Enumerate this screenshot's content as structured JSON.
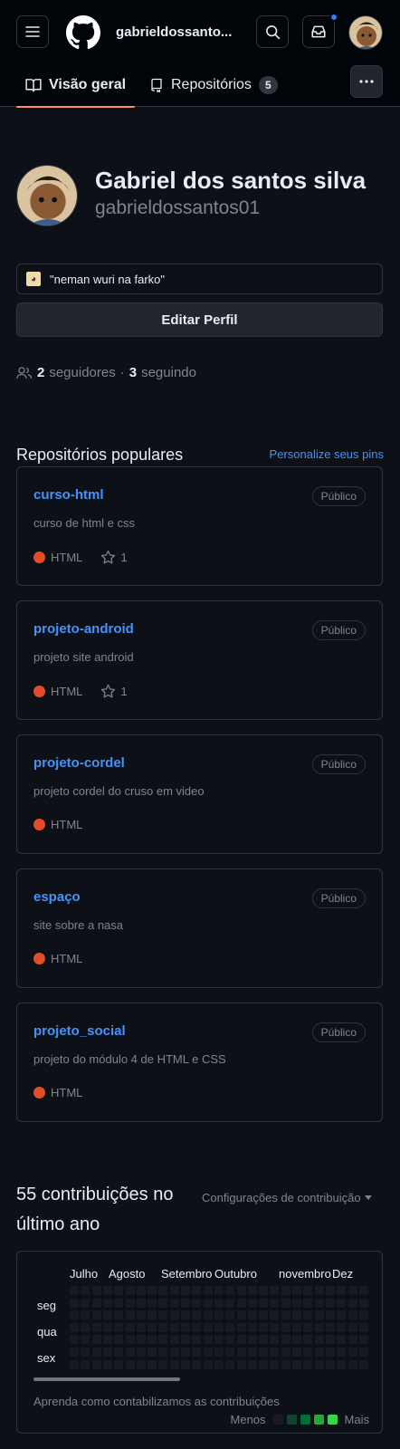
{
  "header": {
    "username": "gabrieldossanto...",
    "icons": [
      "hamburger-icon",
      "github-logo-icon",
      "search-icon",
      "inbox-icon"
    ],
    "accent_color": "#2f81f7"
  },
  "tabs": [
    {
      "label": "Visão geral",
      "icon": "book-icon",
      "selected": true
    },
    {
      "label": "Repositórios",
      "icon": "repo-icon",
      "count": "5"
    }
  ],
  "profile": {
    "name": "Gabriel dos santos silva",
    "login": "gabrieldossantos01",
    "status_text": "\"neman wuri na farko\"",
    "edit_label": "Editar Perfil",
    "followers_count": "2",
    "followers_label": "seguidores",
    "separator": "·",
    "following_count": "3",
    "following_label": "seguindo"
  },
  "pinned": {
    "title": "Repositórios populares",
    "customize": "Personalize seus pins",
    "repos": [
      {
        "name": "curso-html",
        "visibility": "Público",
        "description": "curso de html e css",
        "language": "HTML",
        "stars": "1"
      },
      {
        "name": "projeto-android",
        "visibility": "Público",
        "description": "projeto site android",
        "language": "HTML",
        "stars": "1"
      },
      {
        "name": "projeto-cordel",
        "visibility": "Público",
        "description": "projeto cordel do cruso em video",
        "language": "HTML"
      },
      {
        "name": "espaço",
        "visibility": "Público",
        "description": "site sobre a nasa",
        "language": "HTML"
      },
      {
        "name": "projeto_social",
        "visibility": "Público",
        "description": "projeto do módulo 4 de HTML e CSS",
        "language": "HTML"
      }
    ],
    "language_color": "#e34c26"
  },
  "contributions": {
    "title": "55 contribuições no último ano",
    "settings": "Configurações de contribuição",
    "months": [
      "Julho",
      "Agosto",
      "Setembro",
      "Outubro",
      "novembro",
      "Dez"
    ],
    "days": [
      "seg",
      "qua",
      "sex"
    ],
    "learn": "Aprenda como contabilizamos as contribuições",
    "less": "Menos",
    "more": "Mais",
    "legend_colors": [
      "#161b22",
      "#0e4429",
      "#006d32",
      "#26a641",
      "#39d353"
    ]
  }
}
